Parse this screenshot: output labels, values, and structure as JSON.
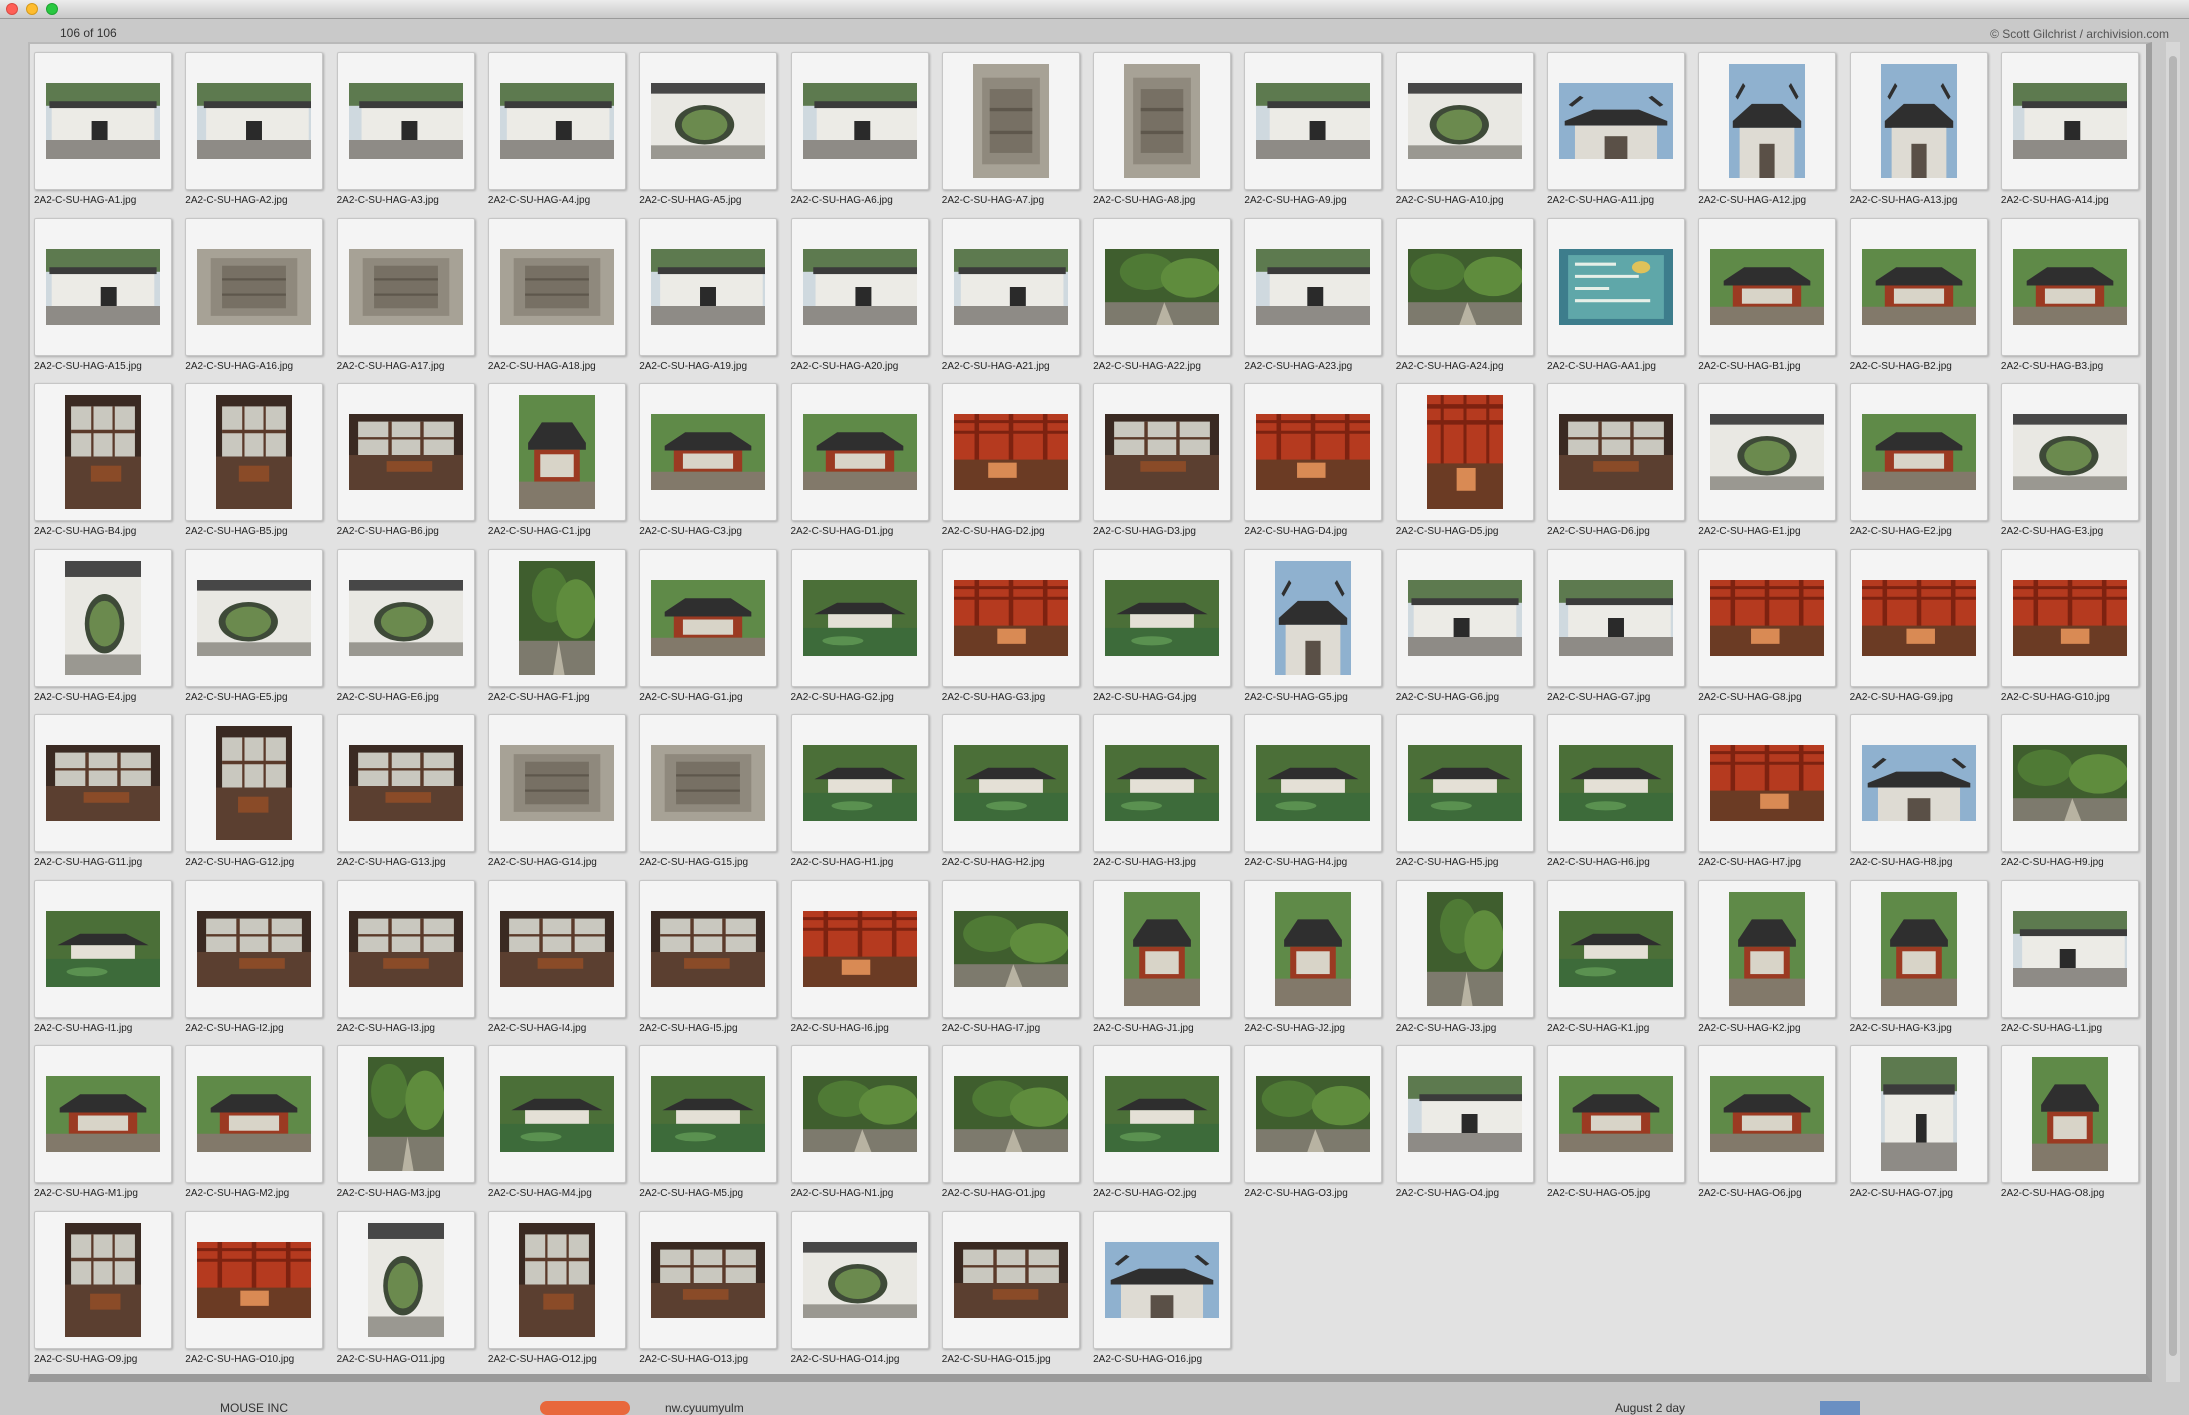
{
  "counter": "106 of 106",
  "credit": "© Scott Gilchrist / archivision.com",
  "thumbnails": [
    {
      "name": "2A2-C-SU-HAG-A1.jpg",
      "orient": "landscape",
      "scene": "building"
    },
    {
      "name": "2A2-C-SU-HAG-A2.jpg",
      "orient": "landscape",
      "scene": "building"
    },
    {
      "name": "2A2-C-SU-HAG-A3.jpg",
      "orient": "landscape",
      "scene": "building"
    },
    {
      "name": "2A2-C-SU-HAG-A4.jpg",
      "orient": "landscape",
      "scene": "building"
    },
    {
      "name": "2A2-C-SU-HAG-A5.jpg",
      "orient": "landscape",
      "scene": "moongate"
    },
    {
      "name": "2A2-C-SU-HAG-A6.jpg",
      "orient": "landscape",
      "scene": "building"
    },
    {
      "name": "2A2-C-SU-HAG-A7.jpg",
      "orient": "portrait",
      "scene": "stone"
    },
    {
      "name": "2A2-C-SU-HAG-A8.jpg",
      "orient": "portrait",
      "scene": "stone"
    },
    {
      "name": "2A2-C-SU-HAG-A9.jpg",
      "orient": "landscape",
      "scene": "building"
    },
    {
      "name": "2A2-C-SU-HAG-A10.jpg",
      "orient": "landscape",
      "scene": "moongate"
    },
    {
      "name": "2A2-C-SU-HAG-A11.jpg",
      "orient": "landscape",
      "scene": "roof"
    },
    {
      "name": "2A2-C-SU-HAG-A12.jpg",
      "orient": "portrait",
      "scene": "roof"
    },
    {
      "name": "2A2-C-SU-HAG-A13.jpg",
      "orient": "portrait",
      "scene": "roof"
    },
    {
      "name": "2A2-C-SU-HAG-A14.jpg",
      "orient": "landscape",
      "scene": "building"
    },
    {
      "name": "2A2-C-SU-HAG-A15.jpg",
      "orient": "landscape",
      "scene": "building"
    },
    {
      "name": "2A2-C-SU-HAG-A16.jpg",
      "orient": "landscape",
      "scene": "stone"
    },
    {
      "name": "2A2-C-SU-HAG-A17.jpg",
      "orient": "landscape",
      "scene": "stone"
    },
    {
      "name": "2A2-C-SU-HAG-A18.jpg",
      "orient": "landscape",
      "scene": "stone"
    },
    {
      "name": "2A2-C-SU-HAG-A19.jpg",
      "orient": "landscape",
      "scene": "building"
    },
    {
      "name": "2A2-C-SU-HAG-A20.jpg",
      "orient": "landscape",
      "scene": "building"
    },
    {
      "name": "2A2-C-SU-HAG-A21.jpg",
      "orient": "landscape",
      "scene": "building"
    },
    {
      "name": "2A2-C-SU-HAG-A22.jpg",
      "orient": "landscape",
      "scene": "garden"
    },
    {
      "name": "2A2-C-SU-HAG-A23.jpg",
      "orient": "landscape",
      "scene": "building"
    },
    {
      "name": "2A2-C-SU-HAG-A24.jpg",
      "orient": "landscape",
      "scene": "garden"
    },
    {
      "name": "2A2-C-SU-HAG-AA1.jpg",
      "orient": "landscape",
      "scene": "map"
    },
    {
      "name": "2A2-C-SU-HAG-B1.jpg",
      "orient": "landscape",
      "scene": "pavilion"
    },
    {
      "name": "2A2-C-SU-HAG-B2.jpg",
      "orient": "landscape",
      "scene": "pavilion"
    },
    {
      "name": "2A2-C-SU-HAG-B3.jpg",
      "orient": "landscape",
      "scene": "pavilion"
    },
    {
      "name": "2A2-C-SU-HAG-B4.jpg",
      "orient": "portrait",
      "scene": "interior"
    },
    {
      "name": "2A2-C-SU-HAG-B5.jpg",
      "orient": "portrait",
      "scene": "interior"
    },
    {
      "name": "2A2-C-SU-HAG-B6.jpg",
      "orient": "landscape",
      "scene": "interior"
    },
    {
      "name": "2A2-C-SU-HAG-C1.jpg",
      "orient": "portrait",
      "scene": "pavilion"
    },
    {
      "name": "2A2-C-SU-HAG-C3.jpg",
      "orient": "landscape",
      "scene": "pavilion"
    },
    {
      "name": "2A2-C-SU-HAG-D1.jpg",
      "orient": "landscape",
      "scene": "pavilion"
    },
    {
      "name": "2A2-C-SU-HAG-D2.jpg",
      "orient": "landscape",
      "scene": "redhall"
    },
    {
      "name": "2A2-C-SU-HAG-D3.jpg",
      "orient": "landscape",
      "scene": "interior"
    },
    {
      "name": "2A2-C-SU-HAG-D4.jpg",
      "orient": "landscape",
      "scene": "redhall"
    },
    {
      "name": "2A2-C-SU-HAG-D5.jpg",
      "orient": "portrait",
      "scene": "redhall"
    },
    {
      "name": "2A2-C-SU-HAG-D6.jpg",
      "orient": "landscape",
      "scene": "interior"
    },
    {
      "name": "2A2-C-SU-HAG-E1.jpg",
      "orient": "landscape",
      "scene": "moongate"
    },
    {
      "name": "2A2-C-SU-HAG-E2.jpg",
      "orient": "landscape",
      "scene": "pavilion"
    },
    {
      "name": "2A2-C-SU-HAG-E3.jpg",
      "orient": "landscape",
      "scene": "moongate"
    },
    {
      "name": "2A2-C-SU-HAG-E4.jpg",
      "orient": "portrait",
      "scene": "moongate"
    },
    {
      "name": "2A2-C-SU-HAG-E5.jpg",
      "orient": "landscape",
      "scene": "moongate"
    },
    {
      "name": "2A2-C-SU-HAG-E6.jpg",
      "orient": "landscape",
      "scene": "moongate"
    },
    {
      "name": "2A2-C-SU-HAG-F1.jpg",
      "orient": "portrait",
      "scene": "garden"
    },
    {
      "name": "2A2-C-SU-HAG-G1.jpg",
      "orient": "landscape",
      "scene": "pavilion"
    },
    {
      "name": "2A2-C-SU-HAG-G2.jpg",
      "orient": "landscape",
      "scene": "pond"
    },
    {
      "name": "2A2-C-SU-HAG-G3.jpg",
      "orient": "landscape",
      "scene": "redhall"
    },
    {
      "name": "2A2-C-SU-HAG-G4.jpg",
      "orient": "landscape",
      "scene": "pond"
    },
    {
      "name": "2A2-C-SU-HAG-G5.jpg",
      "orient": "portrait",
      "scene": "roof"
    },
    {
      "name": "2A2-C-SU-HAG-G6.jpg",
      "orient": "landscape",
      "scene": "building"
    },
    {
      "name": "2A2-C-SU-HAG-G7.jpg",
      "orient": "landscape",
      "scene": "building"
    },
    {
      "name": "2A2-C-SU-HAG-G8.jpg",
      "orient": "landscape",
      "scene": "redhall"
    },
    {
      "name": "2A2-C-SU-HAG-G9.jpg",
      "orient": "landscape",
      "scene": "redhall"
    },
    {
      "name": "2A2-C-SU-HAG-G10.jpg",
      "orient": "landscape",
      "scene": "redhall"
    },
    {
      "name": "2A2-C-SU-HAG-G11.jpg",
      "orient": "landscape",
      "scene": "interior"
    },
    {
      "name": "2A2-C-SU-HAG-G12.jpg",
      "orient": "portrait",
      "scene": "interior"
    },
    {
      "name": "2A2-C-SU-HAG-G13.jpg",
      "orient": "landscape",
      "scene": "interior"
    },
    {
      "name": "2A2-C-SU-HAG-G14.jpg",
      "orient": "landscape",
      "scene": "stone"
    },
    {
      "name": "2A2-C-SU-HAG-G15.jpg",
      "orient": "landscape",
      "scene": "stone"
    },
    {
      "name": "2A2-C-SU-HAG-H1.jpg",
      "orient": "landscape",
      "scene": "pond"
    },
    {
      "name": "2A2-C-SU-HAG-H2.jpg",
      "orient": "landscape",
      "scene": "pond"
    },
    {
      "name": "2A2-C-SU-HAG-H3.jpg",
      "orient": "landscape",
      "scene": "pond"
    },
    {
      "name": "2A2-C-SU-HAG-H4.jpg",
      "orient": "landscape",
      "scene": "pond"
    },
    {
      "name": "2A2-C-SU-HAG-H5.jpg",
      "orient": "landscape",
      "scene": "pond"
    },
    {
      "name": "2A2-C-SU-HAG-H6.jpg",
      "orient": "landscape",
      "scene": "pond"
    },
    {
      "name": "2A2-C-SU-HAG-H7.jpg",
      "orient": "landscape",
      "scene": "redhall"
    },
    {
      "name": "2A2-C-SU-HAG-H8.jpg",
      "orient": "landscape",
      "scene": "roof"
    },
    {
      "name": "2A2-C-SU-HAG-H9.jpg",
      "orient": "landscape",
      "scene": "garden"
    },
    {
      "name": "2A2-C-SU-HAG-I1.jpg",
      "orient": "landscape",
      "scene": "pond"
    },
    {
      "name": "2A2-C-SU-HAG-I2.jpg",
      "orient": "landscape",
      "scene": "interior"
    },
    {
      "name": "2A2-C-SU-HAG-I3.jpg",
      "orient": "landscape",
      "scene": "interior"
    },
    {
      "name": "2A2-C-SU-HAG-I4.jpg",
      "orient": "landscape",
      "scene": "interior"
    },
    {
      "name": "2A2-C-SU-HAG-I5.jpg",
      "orient": "landscape",
      "scene": "interior"
    },
    {
      "name": "2A2-C-SU-HAG-I6.jpg",
      "orient": "landscape",
      "scene": "redhall"
    },
    {
      "name": "2A2-C-SU-HAG-I7.jpg",
      "orient": "landscape",
      "scene": "garden"
    },
    {
      "name": "2A2-C-SU-HAG-J1.jpg",
      "orient": "portrait",
      "scene": "pavilion"
    },
    {
      "name": "2A2-C-SU-HAG-J2.jpg",
      "orient": "portrait",
      "scene": "pavilion"
    },
    {
      "name": "2A2-C-SU-HAG-J3.jpg",
      "orient": "portrait",
      "scene": "garden"
    },
    {
      "name": "2A2-C-SU-HAG-K1.jpg",
      "orient": "landscape",
      "scene": "pond"
    },
    {
      "name": "2A2-C-SU-HAG-K2.jpg",
      "orient": "portrait",
      "scene": "pavilion"
    },
    {
      "name": "2A2-C-SU-HAG-K3.jpg",
      "orient": "portrait",
      "scene": "pavilion"
    },
    {
      "name": "2A2-C-SU-HAG-L1.jpg",
      "orient": "landscape",
      "scene": "building"
    },
    {
      "name": "2A2-C-SU-HAG-M1.jpg",
      "orient": "landscape",
      "scene": "pavilion"
    },
    {
      "name": "2A2-C-SU-HAG-M2.jpg",
      "orient": "landscape",
      "scene": "pavilion"
    },
    {
      "name": "2A2-C-SU-HAG-M3.jpg",
      "orient": "portrait",
      "scene": "garden"
    },
    {
      "name": "2A2-C-SU-HAG-M4.jpg",
      "orient": "landscape",
      "scene": "pond"
    },
    {
      "name": "2A2-C-SU-HAG-M5.jpg",
      "orient": "landscape",
      "scene": "pond"
    },
    {
      "name": "2A2-C-SU-HAG-N1.jpg",
      "orient": "landscape",
      "scene": "garden"
    },
    {
      "name": "2A2-C-SU-HAG-O1.jpg",
      "orient": "landscape",
      "scene": "garden"
    },
    {
      "name": "2A2-C-SU-HAG-O2.jpg",
      "orient": "landscape",
      "scene": "pond"
    },
    {
      "name": "2A2-C-SU-HAG-O3.jpg",
      "orient": "landscape",
      "scene": "garden"
    },
    {
      "name": "2A2-C-SU-HAG-O4.jpg",
      "orient": "landscape",
      "scene": "building"
    },
    {
      "name": "2A2-C-SU-HAG-O5.jpg",
      "orient": "landscape",
      "scene": "pavilion"
    },
    {
      "name": "2A2-C-SU-HAG-O6.jpg",
      "orient": "landscape",
      "scene": "pavilion"
    },
    {
      "name": "2A2-C-SU-HAG-O7.jpg",
      "orient": "portrait",
      "scene": "building"
    },
    {
      "name": "2A2-C-SU-HAG-O8.jpg",
      "orient": "portrait",
      "scene": "pavilion"
    },
    {
      "name": "2A2-C-SU-HAG-O9.jpg",
      "orient": "portrait",
      "scene": "interior"
    },
    {
      "name": "2A2-C-SU-HAG-O10.jpg",
      "orient": "landscape",
      "scene": "redhall"
    },
    {
      "name": "2A2-C-SU-HAG-O11.jpg",
      "orient": "portrait",
      "scene": "moongate"
    },
    {
      "name": "2A2-C-SU-HAG-O12.jpg",
      "orient": "portrait",
      "scene": "interior"
    },
    {
      "name": "2A2-C-SU-HAG-O13.jpg",
      "orient": "landscape",
      "scene": "interior"
    },
    {
      "name": "2A2-C-SU-HAG-O14.jpg",
      "orient": "landscape",
      "scene": "moongate"
    },
    {
      "name": "2A2-C-SU-HAG-O15.jpg",
      "orient": "landscape",
      "scene": "interior"
    },
    {
      "name": "2A2-C-SU-HAG-O16.jpg",
      "orient": "landscape",
      "scene": "roof"
    }
  ],
  "under_window": {
    "a": "MOUSE INC",
    "b": "",
    "c": "nw.cyuumyulm",
    "d": "August 2 day",
    "e": ""
  }
}
